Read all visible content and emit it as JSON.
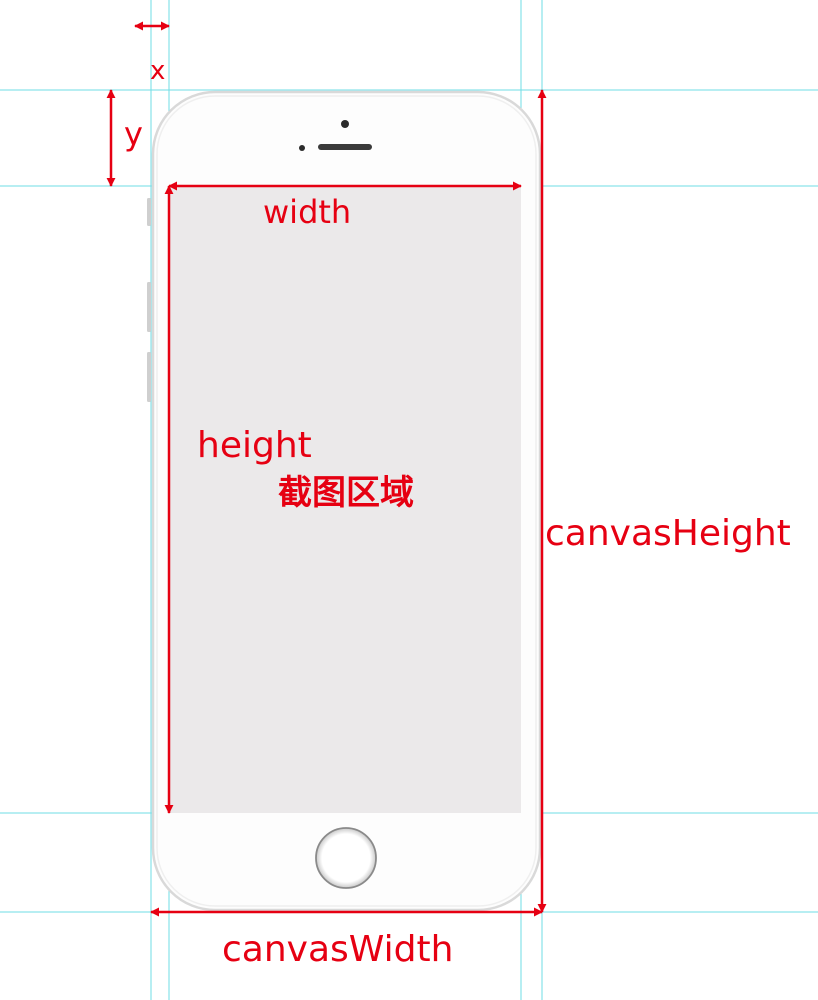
{
  "labels": {
    "x": "x",
    "y": "y",
    "width": "width",
    "height": "height",
    "crop_area": "截图区域",
    "canvas_width": "canvasWidth",
    "canvas_height": "canvasHeight"
  },
  "colors": {
    "annotation": "#e60012",
    "guide": "#6fdde6",
    "phone_body": "#fdfdfd",
    "phone_edge": "#d9d9d9",
    "screen": "#ebe9ea"
  },
  "icons": {
    "camera": "front-camera-icon",
    "speaker": "earpiece-speaker-icon",
    "sensor": "proximity-sensor-icon",
    "home": "home-button-icon"
  }
}
